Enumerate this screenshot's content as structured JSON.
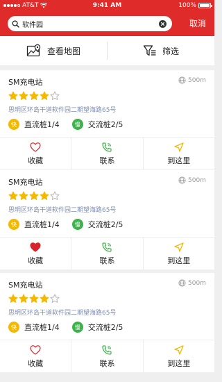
{
  "status_bar": {
    "carrier": "AT&T",
    "time": "9:41 AM",
    "battery": "100%"
  },
  "search": {
    "value": "软件园",
    "cancel_label": "取消"
  },
  "toolbar": {
    "map_label": "查看地图",
    "filter_label": "筛选"
  },
  "colors": {
    "brand": "#e02b2b",
    "star": "#f5b800",
    "fast_badge": "#f5b800",
    "slow_badge": "#3cb34a",
    "phone": "#3cb34a",
    "nav": "#f5b800"
  },
  "stations": [
    {
      "name": "SM充电站",
      "distance": "500m",
      "rating": 4,
      "max_rating": 5,
      "address": "思明区环岛干道软件园二期望海路65号",
      "fast": {
        "badge": "快",
        "label": "直流桩1/4"
      },
      "slow": {
        "badge": "慢",
        "label": "交流桩2/5"
      },
      "favorited": false,
      "actions": {
        "favorite": "收藏",
        "contact": "联系",
        "navigate": "到这里"
      }
    },
    {
      "name": "SM充电站",
      "distance": "500m",
      "rating": 4,
      "max_rating": 5,
      "address": "思明区环岛干道软件园二期望海路65号",
      "fast": {
        "badge": "快",
        "label": "直流桩1/4"
      },
      "slow": {
        "badge": "慢",
        "label": "交流桩2/5"
      },
      "favorited": true,
      "actions": {
        "favorite": "收藏",
        "contact": "联系",
        "navigate": "到这里"
      }
    },
    {
      "name": "SM充电站",
      "distance": "500m",
      "rating": 4,
      "max_rating": 5,
      "address": "思明区环岛干道软件园二期望海路65号",
      "fast": {
        "badge": "快",
        "label": "直流桩1/4"
      },
      "slow": {
        "badge": "慢",
        "label": "交流桩2/5"
      },
      "favorited": false,
      "actions": {
        "favorite": "收藏",
        "contact": "联系",
        "navigate": "到这里"
      }
    }
  ]
}
